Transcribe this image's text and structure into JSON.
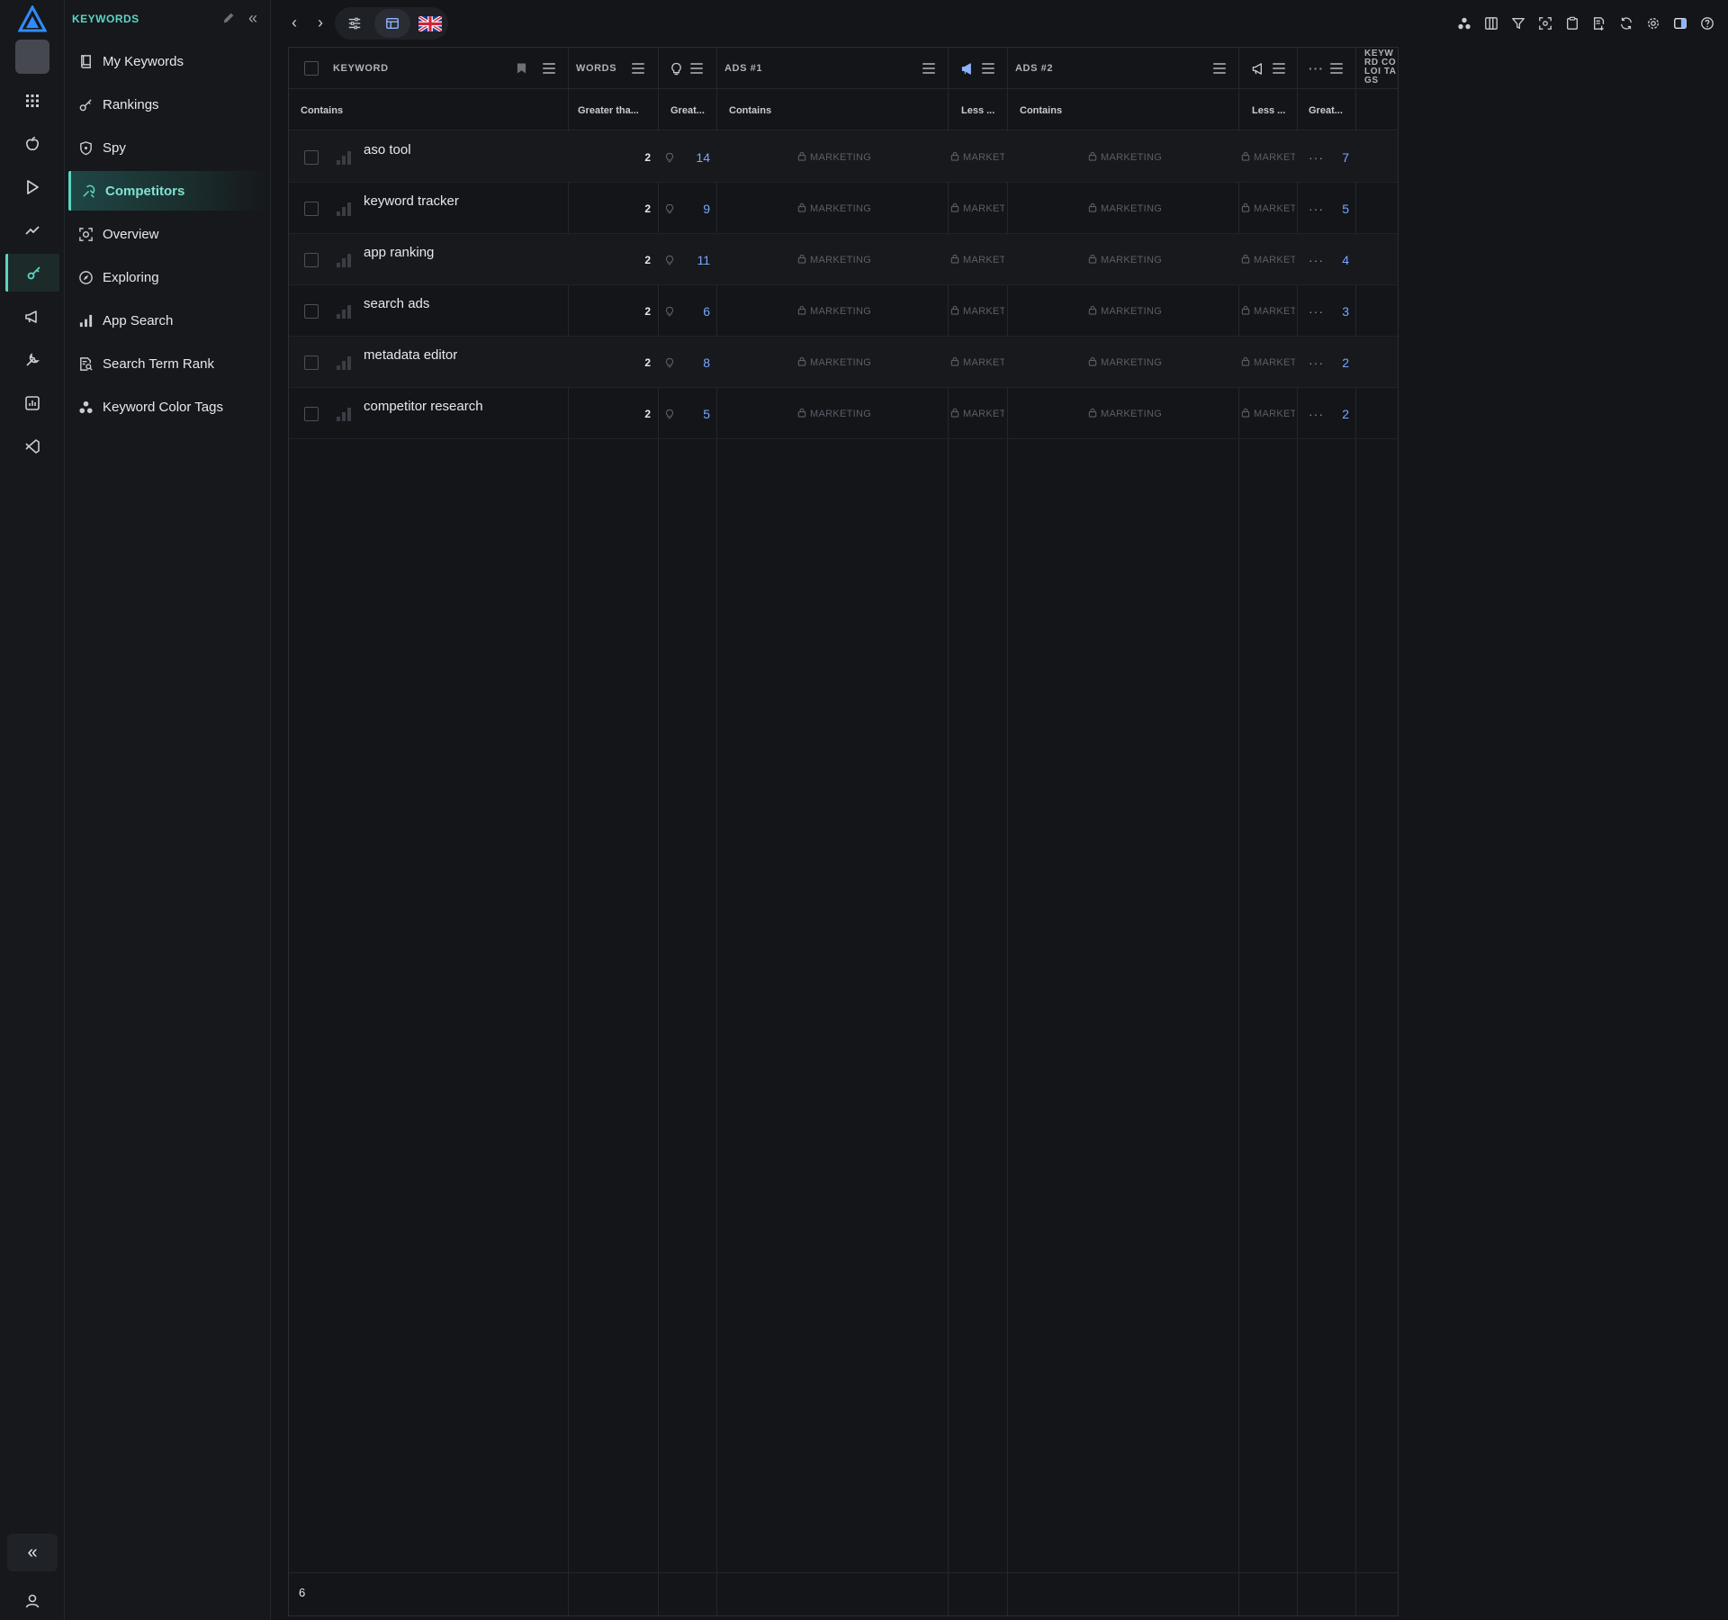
{
  "sidebar": {
    "title": "KEYWORDS",
    "items": [
      {
        "label": "My Keywords",
        "icon": "book-icon"
      },
      {
        "label": "Rankings",
        "icon": "key-icon"
      },
      {
        "label": "Spy",
        "icon": "shield-icon"
      },
      {
        "label": "Competitors",
        "icon": "competitors-icon",
        "active": true
      },
      {
        "label": "Overview",
        "icon": "overview-icon"
      },
      {
        "label": "Exploring",
        "icon": "compass-icon"
      },
      {
        "label": "App Search",
        "icon": "bar-chart-icon"
      },
      {
        "label": "Search Term Rank",
        "icon": "doc-search-icon"
      },
      {
        "label": "Keyword Color Tags",
        "icon": "color-tags-icon"
      }
    ]
  },
  "grid": {
    "headers": {
      "keyword": "KEYWORD",
      "words": "WORDS",
      "ads1": "ADS #1",
      "ads2": "ADS #2",
      "color_tags": "KEYW RD COLOI TAGS"
    },
    "filters": {
      "keyword": "Contains",
      "words": "Greater tha...",
      "difficulty": "Great...",
      "ads1": "Contains",
      "ads1_rank": "Less ...",
      "ads2": "Contains",
      "ads2_rank": "Less ...",
      "extra": "Great..."
    },
    "locked_label": "MARKETING",
    "locked_short": "MARKET",
    "rows": [
      {
        "keyword": "aso tool",
        "words": "2",
        "difficulty": "14",
        "extra": "7"
      },
      {
        "keyword": "keyword tracker",
        "words": "2",
        "difficulty": "9",
        "extra": "5"
      },
      {
        "keyword": "app ranking",
        "words": "2",
        "difficulty": "11",
        "extra": "4"
      },
      {
        "keyword": "search ads",
        "words": "2",
        "difficulty": "6",
        "extra": "3"
      },
      {
        "keyword": "metadata editor",
        "words": "2",
        "difficulty": "8",
        "extra": "2"
      },
      {
        "keyword": "competitor research",
        "words": "2",
        "difficulty": "5",
        "extra": "2"
      }
    ],
    "footer_count": "6"
  },
  "colors": {
    "accent": "#5ad6c3",
    "number": "#7aa7ff",
    "background": "#131519"
  }
}
